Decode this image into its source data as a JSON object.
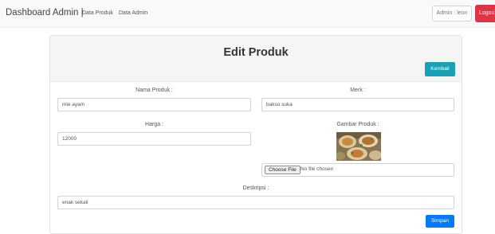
{
  "navbar": {
    "brand": "Dashboard Admin |",
    "links": [
      "Data Produk",
      "Data Admin"
    ],
    "admin_label": "Admin : leon",
    "logout_label": "Logout"
  },
  "form": {
    "title": "Edit Produk",
    "back_label": "Kembali",
    "fields": {
      "nama_label": "Nama Produk :",
      "nama_value": "mie ayam",
      "merk_label": "Merk :",
      "merk_value": "bakso suka",
      "harga_label": "Harga :",
      "harga_value": "12000",
      "gambar_label": "Gambar Produk :",
      "choose_file_label": "Choose File",
      "file_status": "No file chosen",
      "deskripsi_label": "Deskripsi :",
      "deskripsi_value": "enak sekali"
    },
    "save_label": "Simpan"
  },
  "colors": {
    "navbar_bg": "#f8f9fa",
    "logout": "#dc3545",
    "kembali": "#17a2b8",
    "simpan": "#007bff"
  }
}
